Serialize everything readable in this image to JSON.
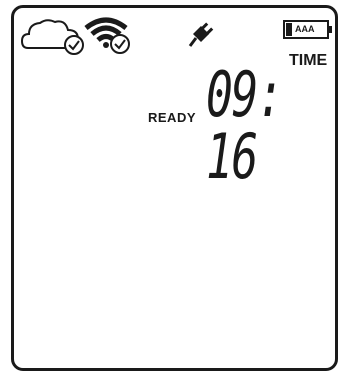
{
  "display": {
    "status": "READY",
    "time_label": "TIME",
    "time_value": "09: 16",
    "battery_label": "AAA"
  },
  "icons": {
    "cloud": "cloud-check-icon",
    "wifi": "wifi-check-icon",
    "power": "plug-icon",
    "battery": "battery-icon"
  }
}
